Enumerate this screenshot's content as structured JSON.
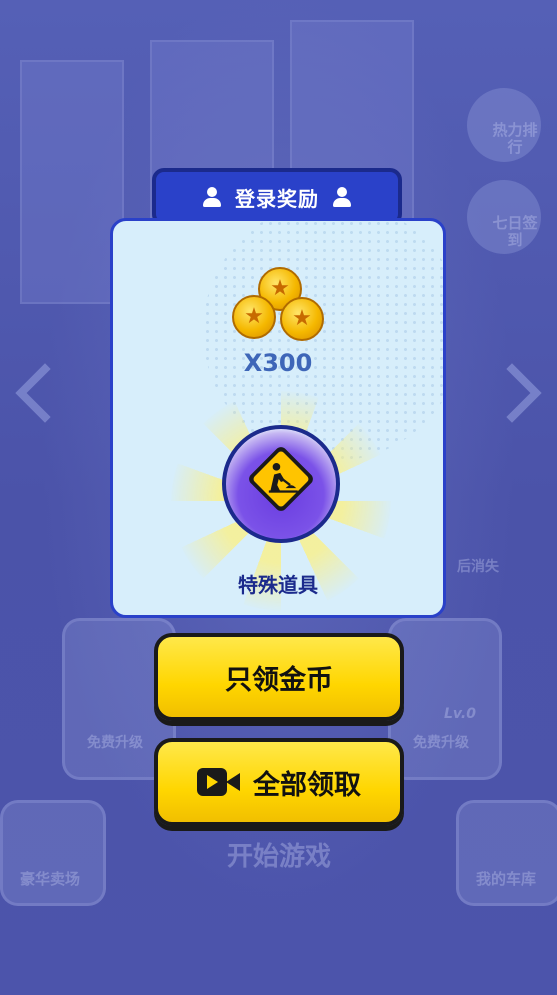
{
  "dialog": {
    "title": "登录奖励",
    "reward_coin_amount": "X300",
    "reward_item_label": "特殊道具",
    "collect_coins_label": "只领金币",
    "collect_all_label": "全部领取"
  },
  "background": {
    "ranking_label": "热力排行",
    "checkin_label": "七日签到",
    "disappear_label": "后消失",
    "upgrade_left_label": "免费升级",
    "upgrade_right_label": "免费升级",
    "level_badge": "Lv.0",
    "start_game_label": "开始游戏",
    "shop_label": "豪华卖场",
    "garage_label": "我的车库"
  },
  "colors": {
    "background": "#4f57ad",
    "title_tab": "#2a41c9",
    "panel": "#d7eefb",
    "button_yellow": "#ffd600",
    "amount_text": "#3e66b8"
  },
  "icons": {
    "title_left": "user-icon",
    "title_right": "user-icon",
    "reward_coins": "coin-stack-icon",
    "reward_item": "construction-sign-icon",
    "collect_all": "video-camera-icon"
  }
}
